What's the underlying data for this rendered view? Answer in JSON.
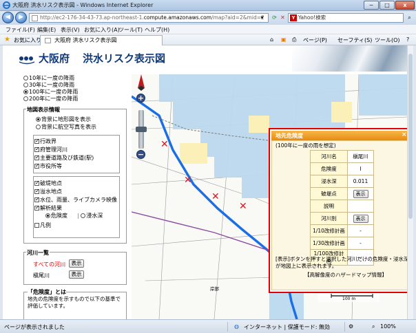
{
  "window": {
    "title": "大阪府 洪水リスク表示図 - Windows Internet Explorer",
    "controls": [
      "−",
      "□",
      "x"
    ]
  },
  "address": {
    "prefix": "http://ec2-176-34-43-73.ap-northeast-1.",
    "domain": "compute.amazonaws.com",
    "suffix": "/map?aid=2&mid=2",
    "search_engine": "Yahoo!検索"
  },
  "menu": [
    "ファイル(F)",
    "編集(E)",
    "表示(V)",
    "お気に入り(A)",
    "ツール(T)",
    "ヘルプ(H)"
  ],
  "favbar": {
    "favorites": "お気に入り",
    "tab_title": "大阪府 洪水リスク表示図",
    "page_menu": "ページ(P)",
    "safety_menu": "セーフティ(S)",
    "tools_menu": "ツール(O)"
  },
  "header": {
    "prefecture": "大阪府",
    "app_title": "洪水リスク表示図"
  },
  "frequency": {
    "options": [
      "10年に一度の降雨",
      "30年に一度の降雨",
      "100年に一度の降雨",
      "200年に一度の降雨"
    ],
    "selected_index": 2
  },
  "map_info": {
    "title": "地図表示情報",
    "background_options": [
      "背景に地形図を表示",
      "背景に航空写真を表示"
    ],
    "background_selected": 0,
    "layers": [
      {
        "label": "行政界",
        "checked": true
      },
      {
        "label": "府管理河川",
        "checked": true
      },
      {
        "label": "主要道路及び鉄道(駅)",
        "checked": true
      },
      {
        "label": "市役所等",
        "checked": true
      },
      {
        "label": "破堤地点",
        "checked": true
      },
      {
        "label": "溢水地点",
        "checked": true
      },
      {
        "label": "水位、雨量、ライブカメラ映像",
        "checked": true
      },
      {
        "label": "解析結果",
        "checked": true
      }
    ],
    "analysis_options": [
      "危険度",
      "浸水深"
    ],
    "analysis_selected": 0,
    "legend_label": "凡例",
    "legend_checked": false
  },
  "rivers": {
    "title": "河川一覧",
    "items": [
      {
        "label": "すべての河川",
        "button": "表示",
        "highlight": true
      },
      {
        "label": "槇尾川",
        "button": "表示",
        "highlight": false
      }
    ]
  },
  "risk_info": {
    "title": "「危険度」とは",
    "text": "地先の危険度を示すもので以下の基準で評価しています。"
  },
  "popup": {
    "title": "地先危険度",
    "close": "×",
    "note": "(100年に一度の雨を想定)",
    "table": {
      "river_name_label": "河川名",
      "river_name_value": "槇尾川",
      "risk_label": "危険度",
      "risk_value": "Ⅰ",
      "depth_label": "浸水深",
      "depth_value": "0.011",
      "breach_label": "破堤点",
      "breach_button": "表示",
      "description_label": "説明",
      "by_river_label": "河川別",
      "by_river_button": "表示",
      "plan10_label": "1/10改修計画",
      "plan10_value": "-",
      "plan30_label": "1/30改修計画",
      "plan30_value": "-",
      "plan100_label": "1/100改修計画",
      "plan100_value": "-"
    },
    "message": "[表示]ボタンを押すと選択した河川だけの危険度・浸水深が地図上に表示されます。",
    "link": "【高解像度のハザードマップ情報】"
  },
  "map": {
    "scale_label": "100 m",
    "place_label": "岸部"
  },
  "status": {
    "left": "ページが表示されました",
    "zone": "インターネット | 保護モード: 無効",
    "zoom": "100%"
  },
  "colors": {
    "flood_blue": "#bcd9ef",
    "flood_yellow": "#fbf1b8",
    "river_blue": "#1a6ee6",
    "marker_red": "#e8101e",
    "popup_border": "#e00000",
    "popup_header": "#e98a10",
    "title_blue": "#103a7a"
  }
}
